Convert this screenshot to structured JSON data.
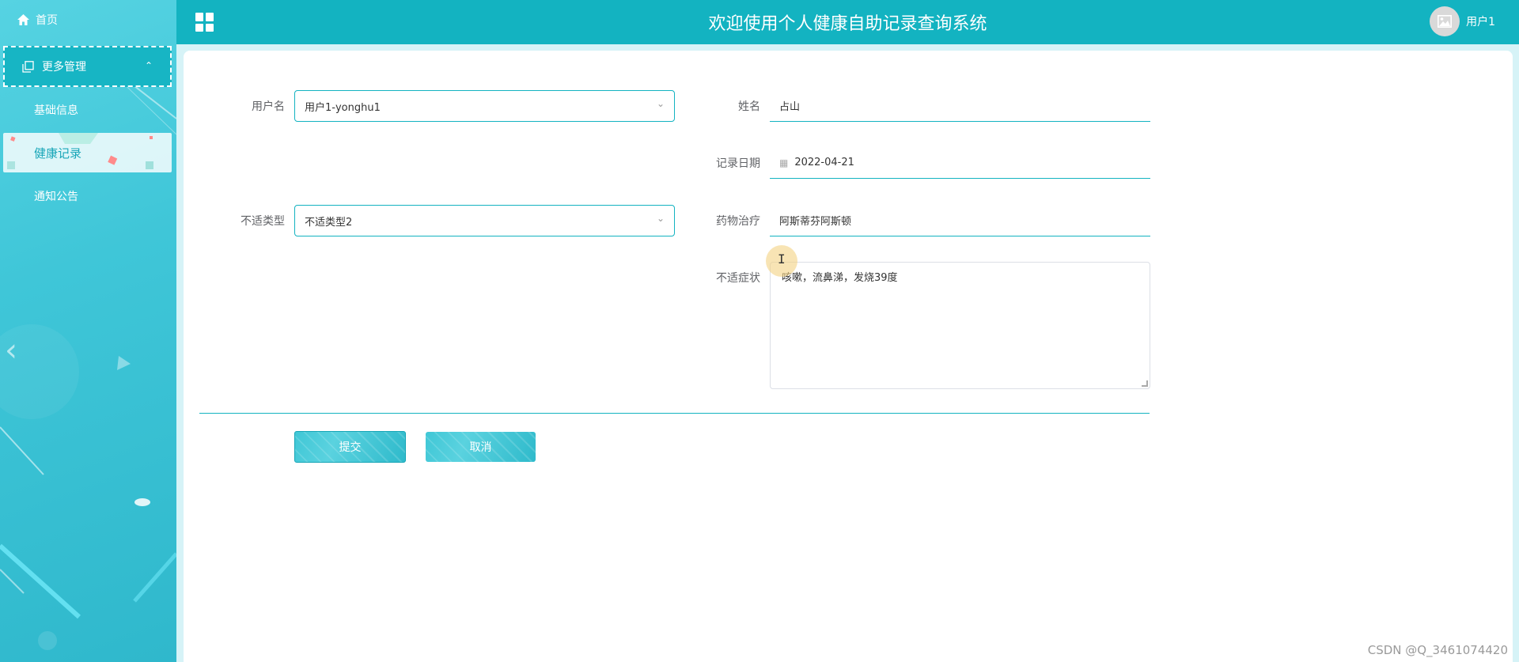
{
  "header": {
    "title": "欢迎使用个人健康自助记录查询系统",
    "username": "用户1"
  },
  "sidebar": {
    "home_label": "首页",
    "group_label": "更多管理",
    "items": [
      {
        "label": "基础信息"
      },
      {
        "label": "健康记录",
        "active": true
      },
      {
        "label": "通知公告"
      }
    ]
  },
  "form": {
    "username": {
      "label": "用户名",
      "value": "用户1-yonghu1"
    },
    "name": {
      "label": "姓名",
      "value": "占山"
    },
    "record_date": {
      "label": "记录日期",
      "value": "2022-04-21"
    },
    "discomfort_type": {
      "label": "不适类型",
      "value": "不适类型2"
    },
    "medication": {
      "label": "药物治疗",
      "value": "阿斯蒂芬阿斯顿"
    },
    "symptoms": {
      "label": "不适症状",
      "value": "咳嗽，流鼻涕，发烧39度"
    }
  },
  "actions": {
    "submit": "提交",
    "cancel": "取消"
  },
  "watermark": "CSDN @Q_3461074420",
  "colors": {
    "primary": "#13b3c1",
    "sidebar": "#3fc6d8"
  }
}
